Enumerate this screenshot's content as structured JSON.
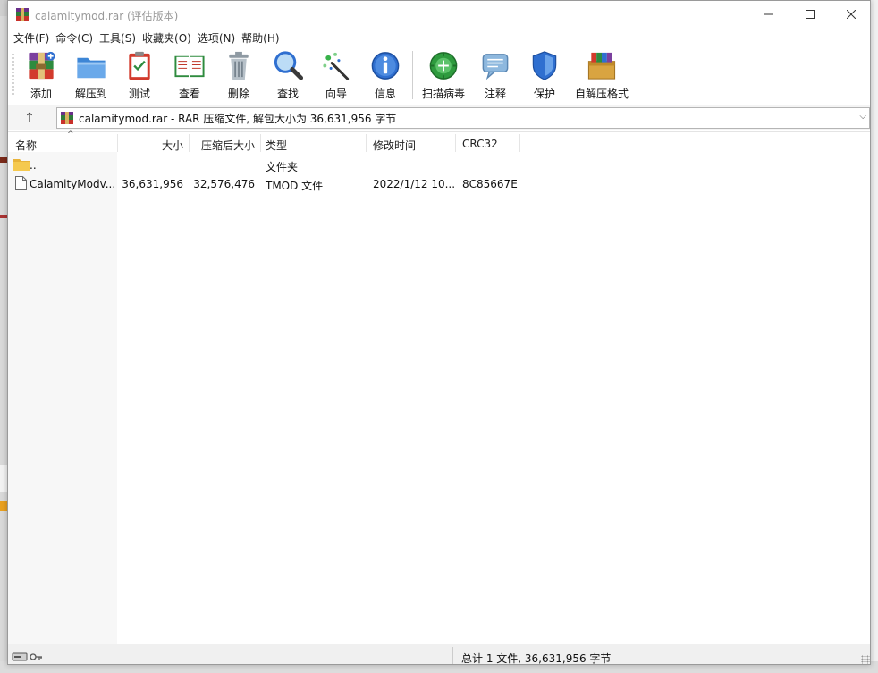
{
  "window": {
    "title": "calamitymod.rar (评估版本)",
    "controls": {
      "minimize": "—",
      "maximize": "☐",
      "close": "✕"
    }
  },
  "menu": {
    "items": [
      "文件(F)",
      "命令(C)",
      "工具(S)",
      "收藏夹(O)",
      "选项(N)",
      "帮助(H)"
    ]
  },
  "toolbar": {
    "buttons": [
      {
        "label": "添加",
        "icon": "add-archive-icon"
      },
      {
        "label": "解压到",
        "icon": "extract-folder-icon"
      },
      {
        "label": "测试",
        "icon": "test-clipboard-icon"
      },
      {
        "label": "查看",
        "icon": "view-book-icon"
      },
      {
        "label": "删除",
        "icon": "trash-can-icon"
      },
      {
        "label": "查找",
        "icon": "magnifier-icon"
      },
      {
        "label": "向导",
        "icon": "wizard-wand-icon"
      },
      {
        "label": "信息",
        "icon": "info-icon"
      },
      {
        "label": "扫描病毒",
        "icon": "virus-scan-icon"
      },
      {
        "label": "注释",
        "icon": "comment-icon"
      },
      {
        "label": "保护",
        "icon": "shield-icon"
      },
      {
        "label": "自解压格式",
        "icon": "sfx-box-icon"
      }
    ]
  },
  "address": {
    "up_label": "↑",
    "path": "calamitymod.rar - RAR 压缩文件, 解包大小为 36,631,956 字节",
    "dropdown": "⌵"
  },
  "columns": {
    "name": "名称",
    "size": "大小",
    "packed": "压缩后大小",
    "type": "类型",
    "modified": "修改时间",
    "crc": "CRC32"
  },
  "files": [
    {
      "name": "..",
      "size": "",
      "packed": "",
      "type": "文件夹",
      "modified": "",
      "crc": ""
    },
    {
      "name": "CalamityModv...",
      "size": "36,631,956",
      "packed": "32,576,476",
      "type": "TMOD 文件",
      "modified": "2022/1/12 10...",
      "crc": "8C85667E"
    }
  ],
  "status": {
    "summary": "总计 1 文件, 36,631,956 字节"
  },
  "colors": {
    "accent_blue": "#2f6fd0",
    "title_gray": "#9a9a9a"
  }
}
